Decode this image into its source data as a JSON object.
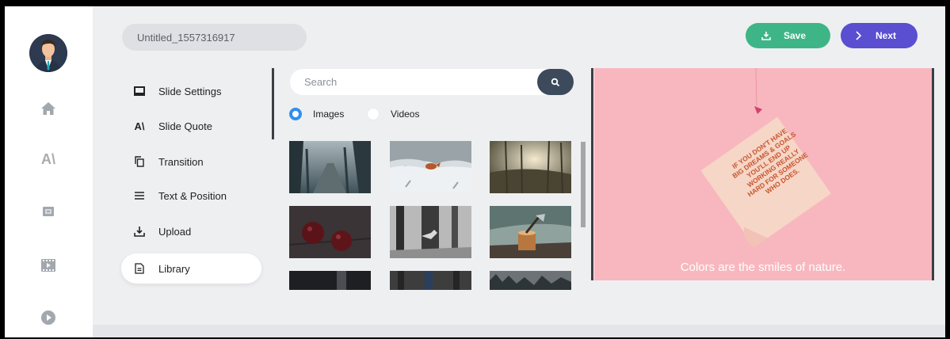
{
  "project": {
    "title": "Untitled_1557316917"
  },
  "toolbar": {
    "save_label": "Save",
    "next_label": "Next"
  },
  "rail": {
    "icons": [
      "avatar",
      "home-icon",
      "font-size-icon",
      "media-icon",
      "video-clip-icon",
      "play-icon"
    ],
    "aa_glyph": "A\\"
  },
  "menu": {
    "items": [
      {
        "label": "Slide Settings",
        "icon": "slide-icon"
      },
      {
        "label": "Slide Quote",
        "icon": "font-size-icon",
        "glyph": "A\\"
      },
      {
        "label": "Transition",
        "icon": "copy-icon"
      },
      {
        "label": "Text & Position",
        "icon": "menu-lines-icon"
      },
      {
        "label": "Upload",
        "icon": "upload-icon"
      },
      {
        "label": "Library",
        "icon": "document-icon",
        "active": true
      }
    ]
  },
  "library": {
    "search_placeholder": "Search",
    "media_types": [
      {
        "label": "Images",
        "selected": true
      },
      {
        "label": "Videos",
        "selected": false
      }
    ]
  },
  "preview": {
    "note_text": "IF YOU DON'T HAVE BIG DREAMS & GOALS YOU'LL END UP WORKING REALLY HARD FOR SOMEONE WHO DOES.",
    "caption": "Colors are the smiles of nature."
  },
  "colors": {
    "save": "#3eb587",
    "next": "#5a4ed1",
    "radio_on": "#2f8ff0",
    "preview_bg": "#f8b7be",
    "search_button": "#3c4a5c"
  }
}
